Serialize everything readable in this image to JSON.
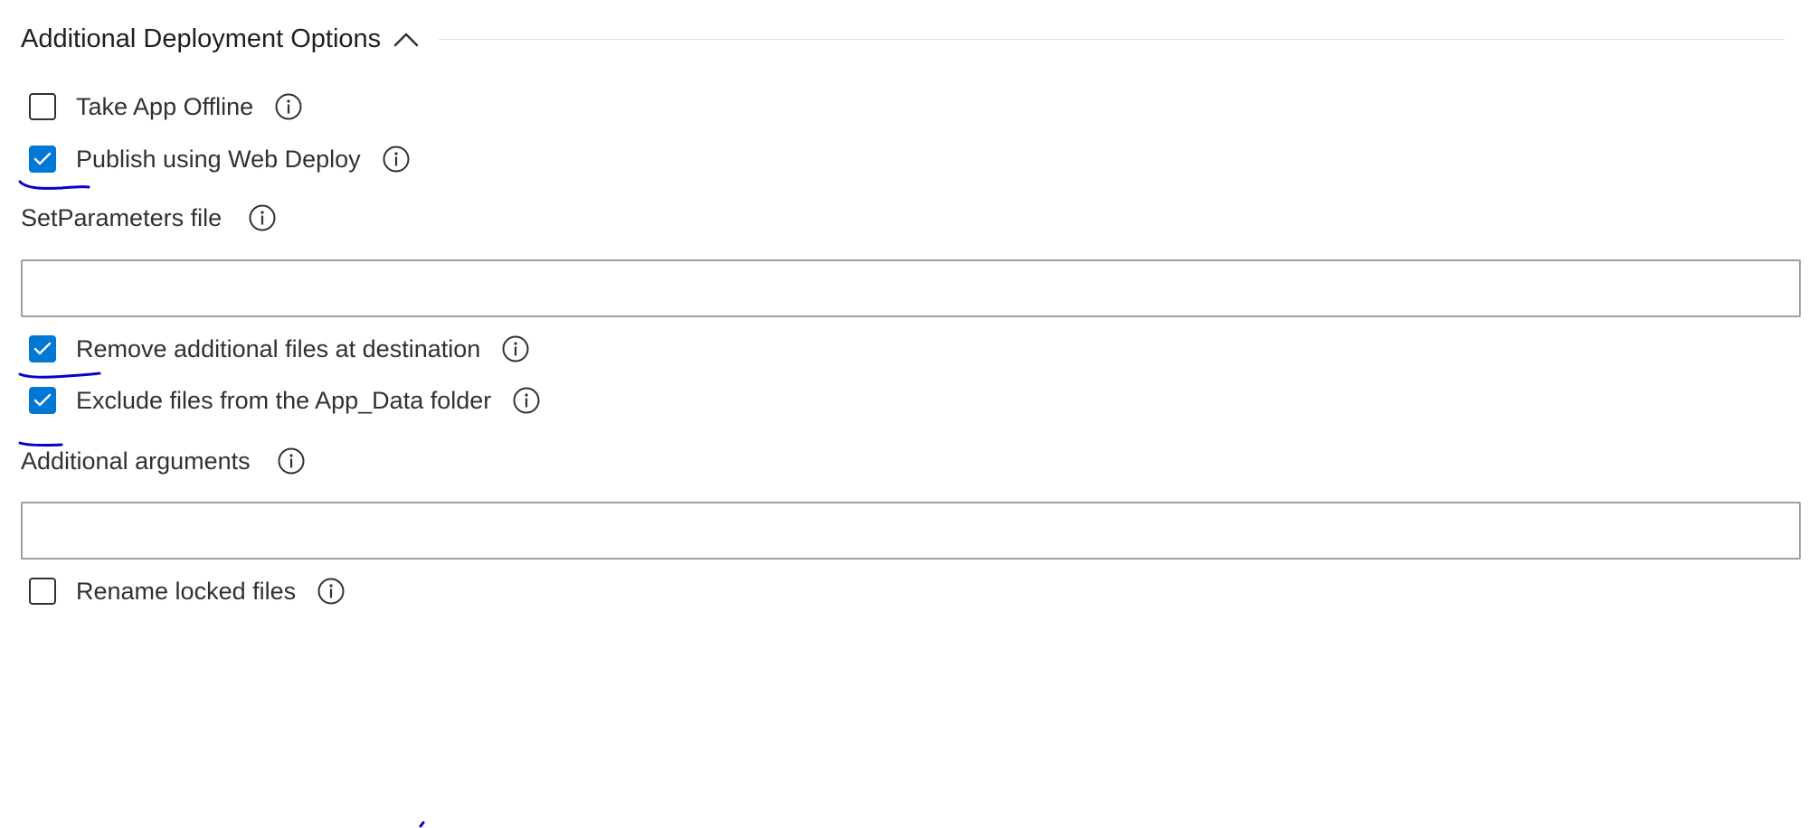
{
  "section": {
    "title": "Additional Deployment Options",
    "expanded": true,
    "chevron_icon": "chevron-up-icon"
  },
  "options": {
    "take_app_offline": {
      "label": "Take App Offline",
      "checked": false
    },
    "publish_web_deploy": {
      "label": "Publish using Web Deploy",
      "checked": true
    },
    "remove_additional_files": {
      "label": "Remove additional files at destination",
      "checked": true
    },
    "exclude_app_data": {
      "label": "Exclude files from the App_Data folder",
      "checked": true
    },
    "rename_locked_files": {
      "label": "Rename locked files",
      "checked": false
    }
  },
  "fields": {
    "set_parameters_file": {
      "label": "SetParameters file",
      "value": ""
    },
    "additional_arguments": {
      "label": "Additional arguments",
      "value": ""
    }
  },
  "icons": {
    "info": "info-circle-icon",
    "check": "checkmark-icon"
  },
  "colors": {
    "accent": "#0078d4",
    "text": "#323130",
    "input_border": "#a19f9d",
    "annotation_ink": "#0a00c8"
  }
}
